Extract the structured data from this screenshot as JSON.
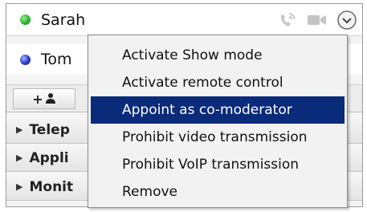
{
  "participants": [
    {
      "name": "Sarah",
      "status_color": "#2fb12f"
    },
    {
      "name": "Tom",
      "status_color": "#2438c9"
    }
  ],
  "sarah_tools": [
    {
      "icon": "voip-phone-icon"
    },
    {
      "icon": "video-camera-icon"
    },
    {
      "icon": "chevron-down-circle-icon"
    }
  ],
  "toolbar": {
    "add_button_label": "+",
    "add_button_icon": "user-icon"
  },
  "sections": [
    {
      "label": "Telep"
    },
    {
      "label": "Appli"
    },
    {
      "label": "Monit"
    }
  ],
  "context_menu": {
    "items": [
      {
        "label": "Activate Show mode",
        "selected": false
      },
      {
        "label": "Activate remote control",
        "selected": false
      },
      {
        "label": "Appoint as co-moderator",
        "selected": true
      },
      {
        "label": "Prohibit video transmission",
        "selected": false
      },
      {
        "label": "Prohibit VoIP transmission",
        "selected": false
      },
      {
        "label": "Remove",
        "selected": false
      }
    ],
    "highlight_color": "#0a2a7a"
  }
}
